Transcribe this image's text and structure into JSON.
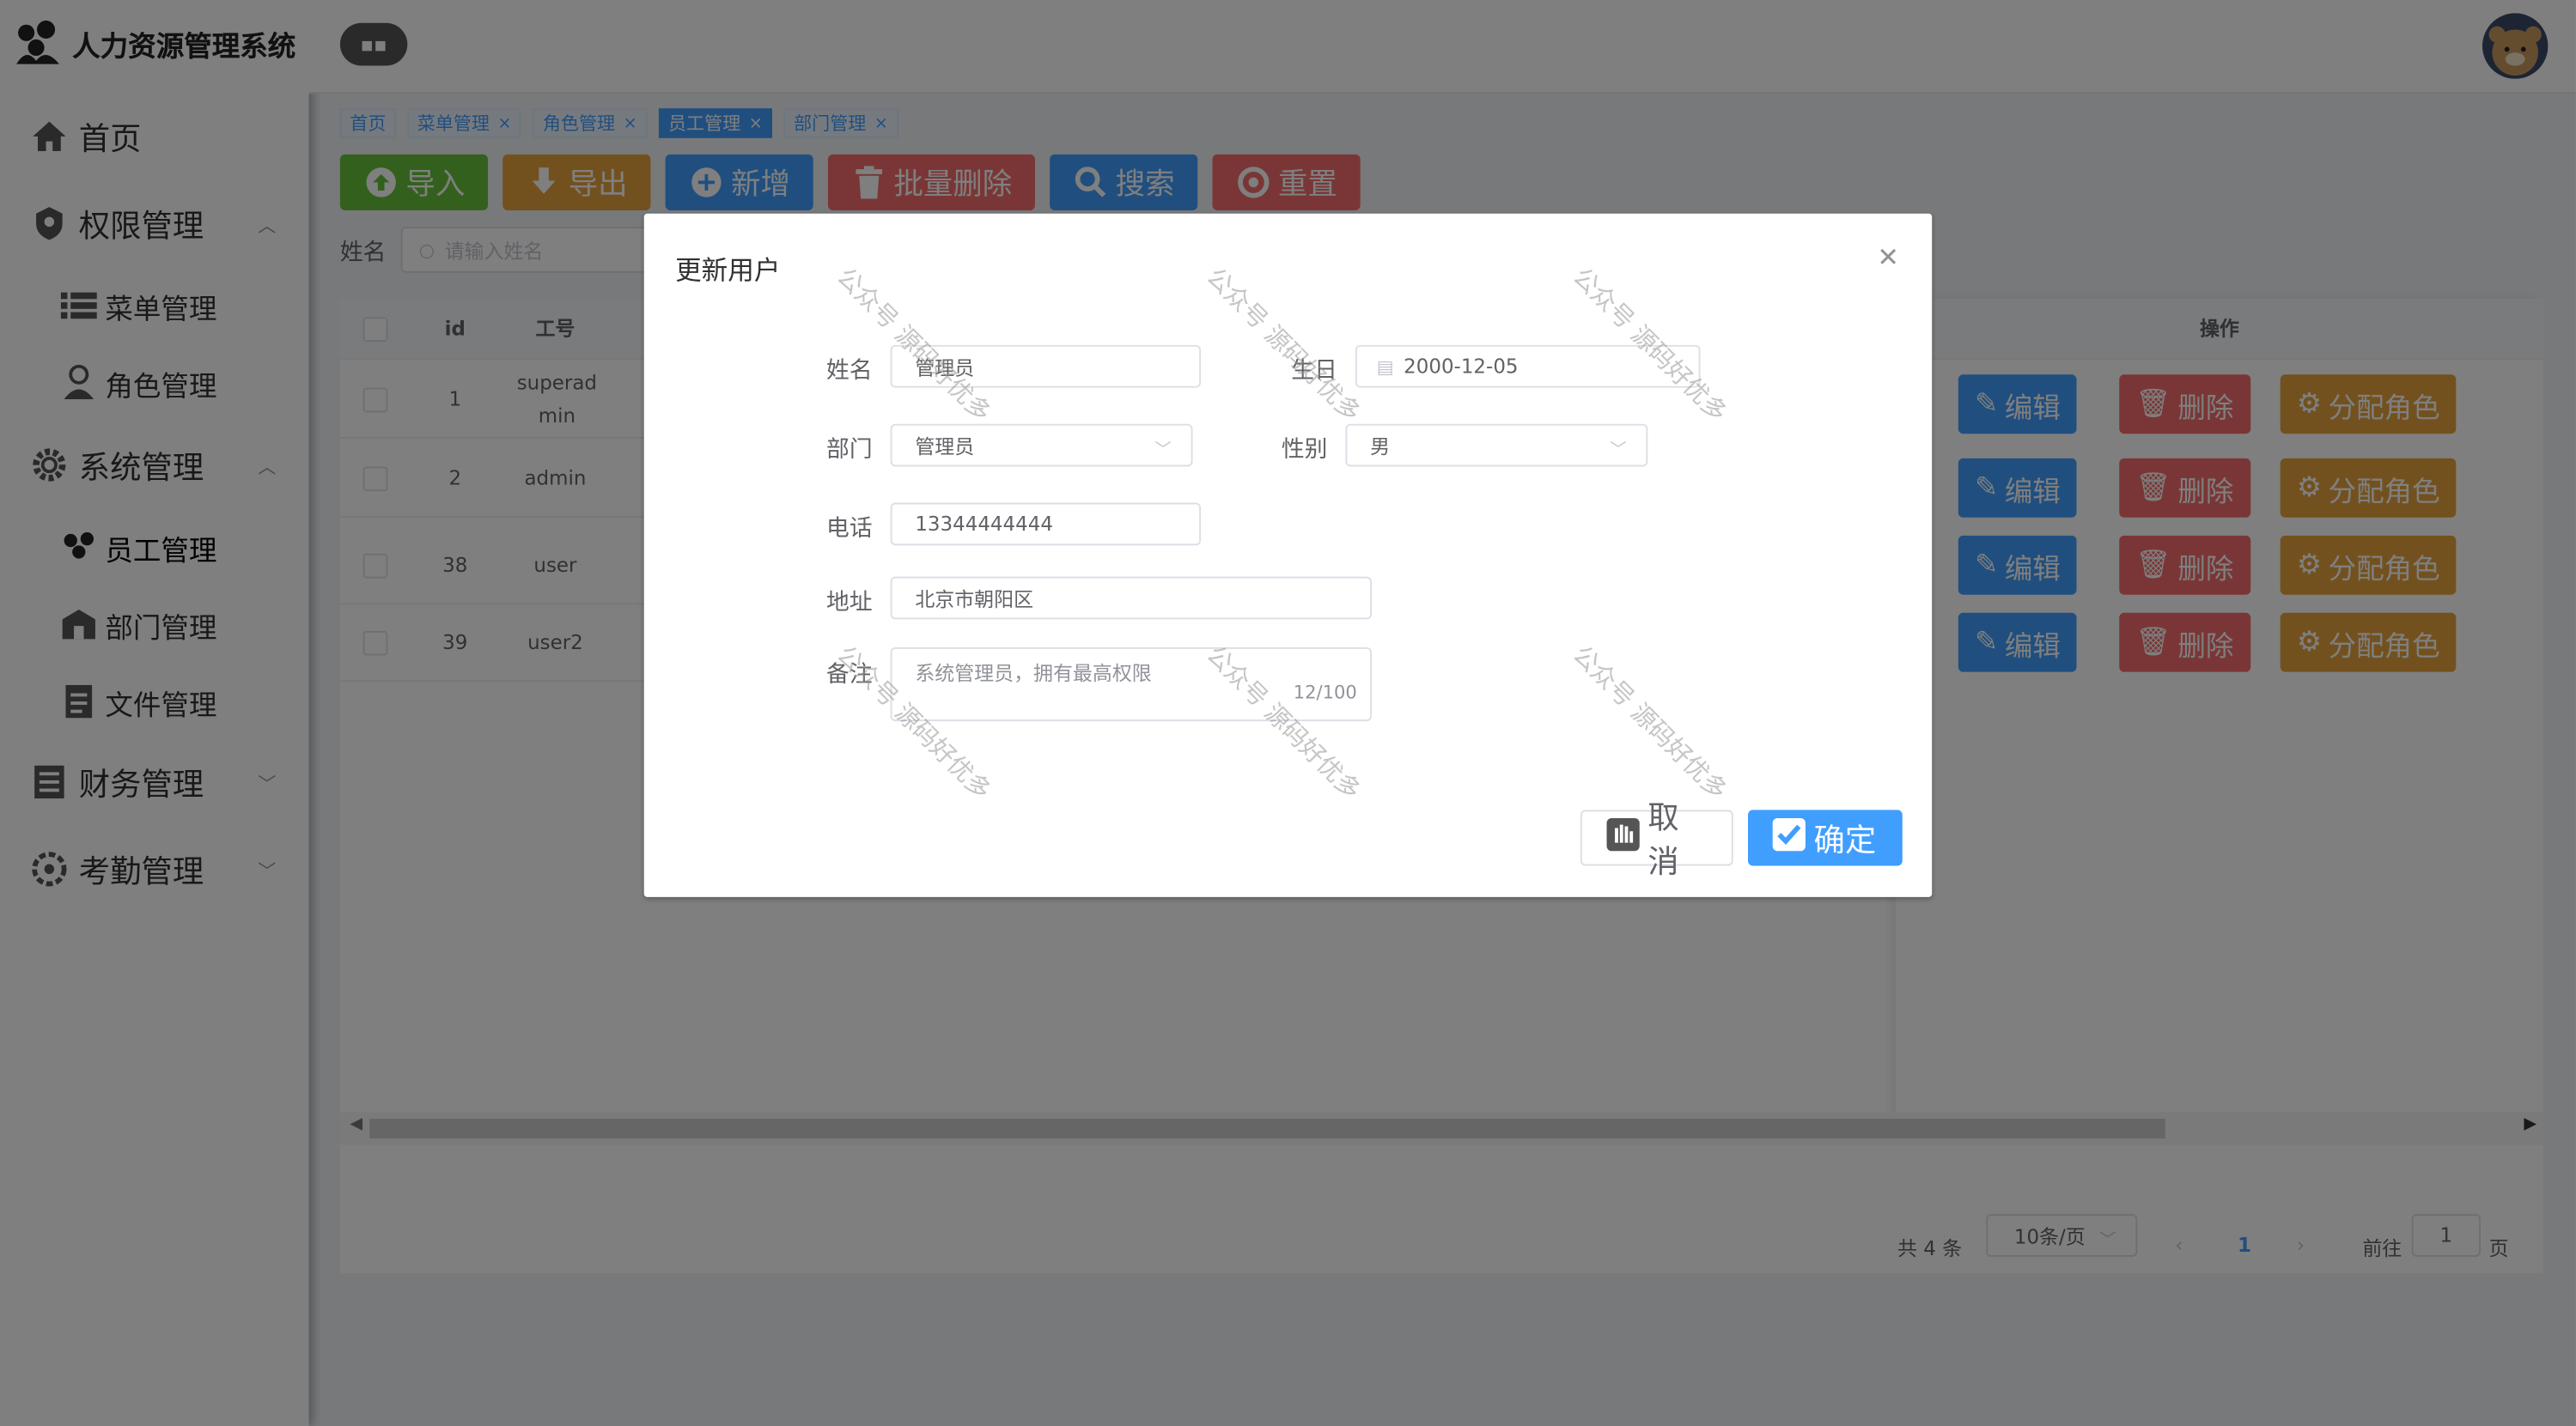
{
  "app": {
    "title": "人力资源管理系统"
  },
  "sidebar": {
    "items": [
      {
        "label": "首页",
        "icon": "home-icon"
      },
      {
        "label": "权限管理",
        "icon": "shield-icon",
        "expanded": true,
        "children": [
          {
            "label": "菜单管理",
            "icon": "list-icon"
          },
          {
            "label": "角色管理",
            "icon": "user-icon"
          }
        ]
      },
      {
        "label": "系统管理",
        "icon": "gear-icon",
        "expanded": true,
        "children": [
          {
            "label": "员工管理",
            "icon": "people-icon",
            "active": true
          },
          {
            "label": "部门管理",
            "icon": "building-icon"
          },
          {
            "label": "文件管理",
            "icon": "document-icon"
          }
        ]
      },
      {
        "label": "财务管理",
        "icon": "ledger-icon",
        "expanded": false
      },
      {
        "label": "考勤管理",
        "icon": "clock-icon",
        "expanded": false
      }
    ]
  },
  "tags": [
    {
      "label": "首页",
      "closable": false,
      "active": false
    },
    {
      "label": "菜单管理",
      "closable": true,
      "active": false
    },
    {
      "label": "角色管理",
      "closable": true,
      "active": false
    },
    {
      "label": "员工管理",
      "closable": true,
      "active": true
    },
    {
      "label": "部门管理",
      "closable": true,
      "active": false
    }
  ],
  "toolbar": {
    "import": "导入",
    "export": "导出",
    "add": "新增",
    "batch_delete": "批量删除",
    "search": "搜索",
    "reset": "重置"
  },
  "search": {
    "label": "姓名",
    "placeholder": "请输入姓名"
  },
  "table": {
    "headers": {
      "id": "id",
      "job_no": "工号",
      "actions": "操作"
    },
    "rows": [
      {
        "id": "1",
        "job_no": "superadmin"
      },
      {
        "id": "2",
        "job_no": "admin"
      },
      {
        "id": "38",
        "job_no": "user"
      },
      {
        "id": "39",
        "job_no": "user2"
      }
    ],
    "action_labels": {
      "edit": "编辑",
      "delete": "删除",
      "assign_role": "分配角色"
    }
  },
  "pagination": {
    "total": "共 4 条",
    "page_size": "10条/页",
    "current_page": "1",
    "goto_prefix": "前往",
    "goto_value": "1",
    "goto_suffix": "页"
  },
  "dialog": {
    "title": "更新用户",
    "fields": {
      "name": {
        "label": "姓名",
        "value": "管理员"
      },
      "birthday": {
        "label": "生日",
        "value": "2000-12-05"
      },
      "department": {
        "label": "部门",
        "value": "管理员"
      },
      "gender": {
        "label": "性别",
        "value": "男"
      },
      "phone": {
        "label": "电话",
        "value": "13344444444"
      },
      "address": {
        "label": "地址",
        "value": "北京市朝阳区"
      },
      "remark": {
        "label": "备注",
        "value": "系统管理员，拥有最高权限",
        "count": "12/100"
      }
    },
    "cancel": "取消",
    "confirm": "确定"
  },
  "watermark": "公众号 源码好优多",
  "colors": {
    "primary": "#409eff",
    "success": "#67c23a",
    "warning": "#e6a23c",
    "danger": "#f56c6c"
  }
}
